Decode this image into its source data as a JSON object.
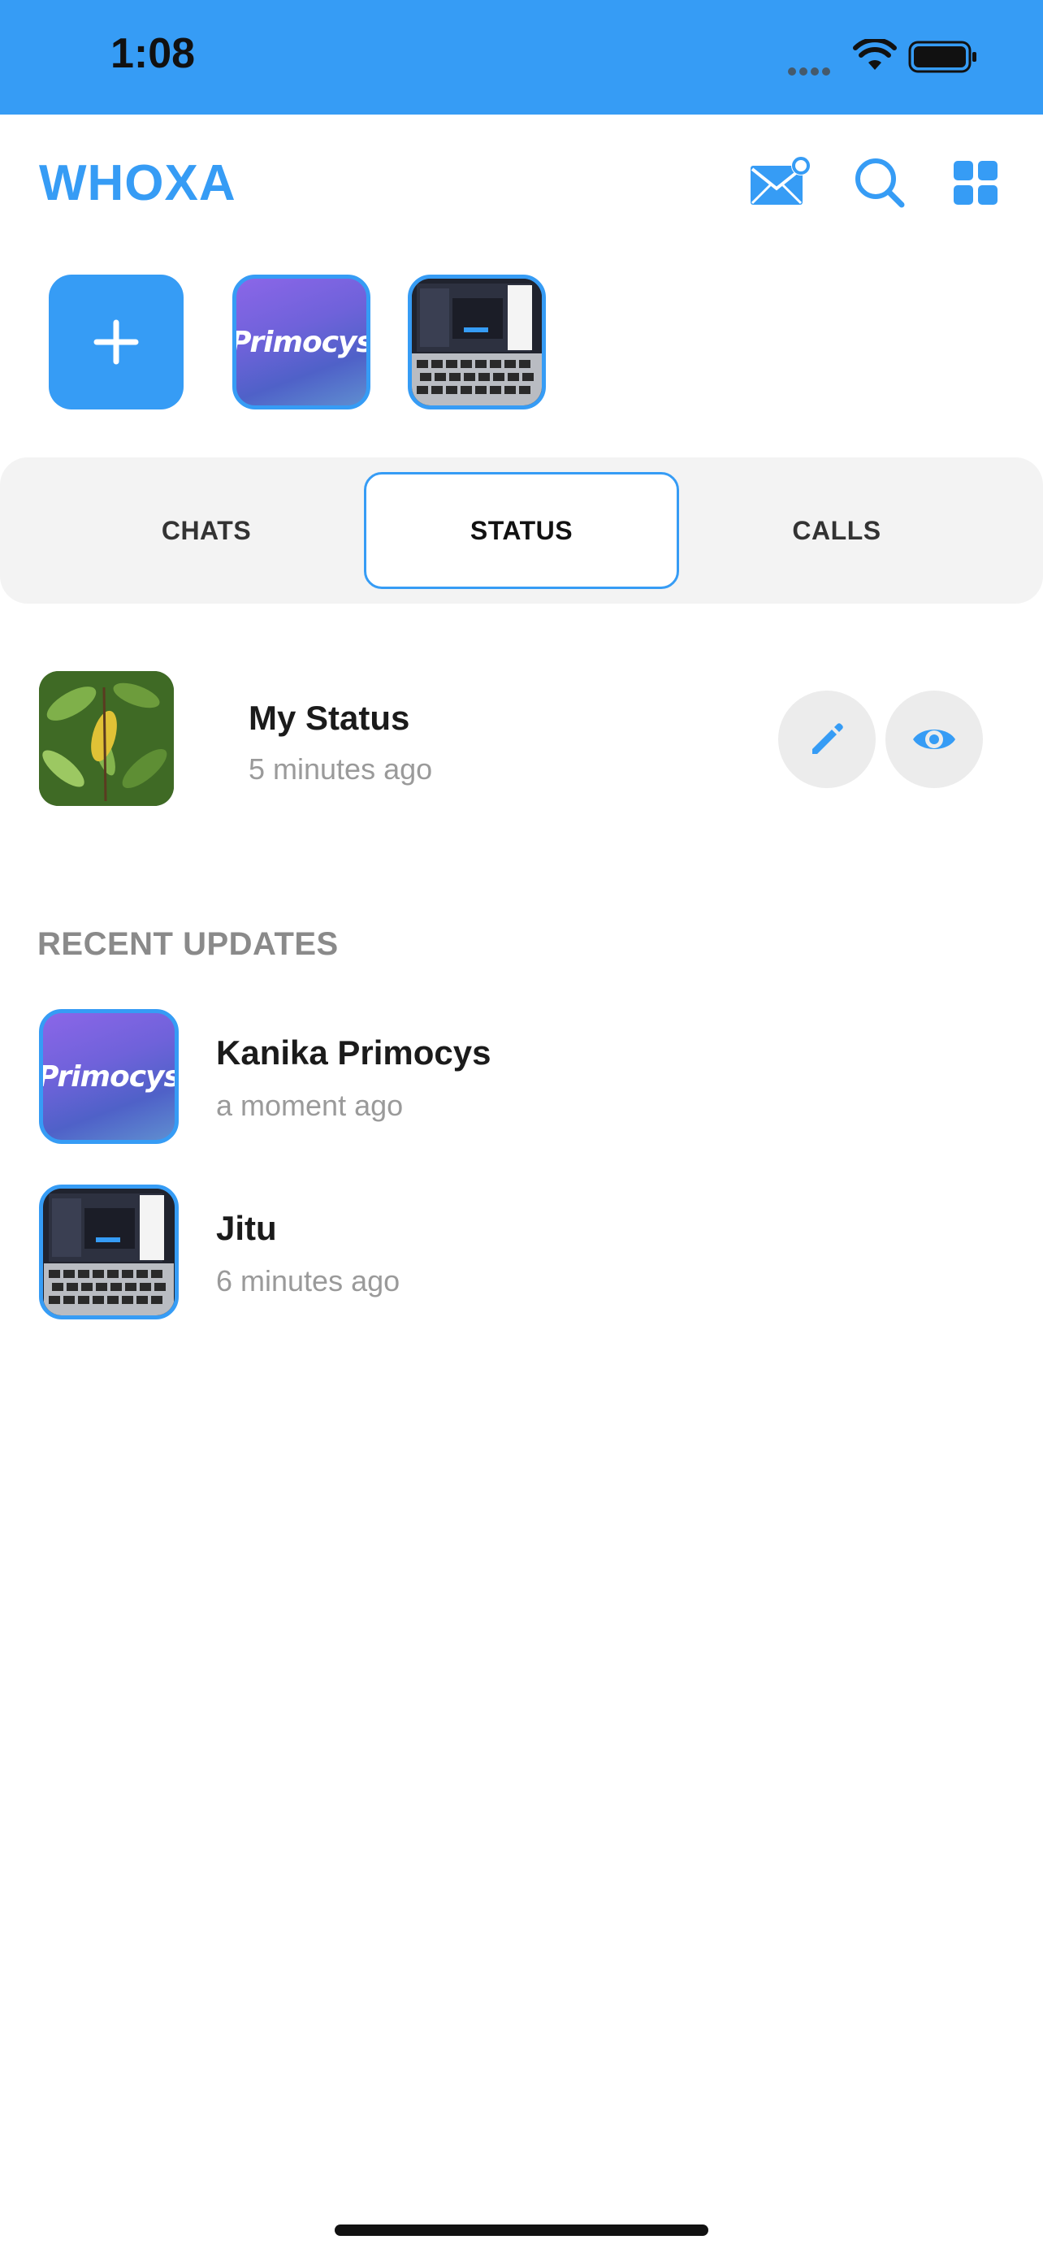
{
  "status_bar": {
    "time": "1:08"
  },
  "app": {
    "title": "WHOXA",
    "accent_color": "#369cf5"
  },
  "header_icons": [
    "mail-notification-icon",
    "search-icon",
    "grid-menu-icon"
  ],
  "stories": {
    "add_label": "+",
    "items": [
      {
        "thumb": "primocys-logo",
        "logo_text": "Primocys"
      },
      {
        "thumb": "laptop-photo"
      }
    ]
  },
  "tabs": [
    {
      "label": "CHATS",
      "active": false
    },
    {
      "label": "STATUS",
      "active": true
    },
    {
      "label": "CALLS",
      "active": false
    }
  ],
  "my_status": {
    "title": "My Status",
    "time": "5 minutes ago",
    "actions": [
      "edit-pencil-icon",
      "view-eye-icon"
    ]
  },
  "recent": {
    "heading": "RECENT UPDATES",
    "items": [
      {
        "name": "Kanika Primocys",
        "time": "a moment ago",
        "logo_text": "Primocys"
      },
      {
        "name": "Jitu",
        "time": "6 minutes ago"
      }
    ]
  }
}
